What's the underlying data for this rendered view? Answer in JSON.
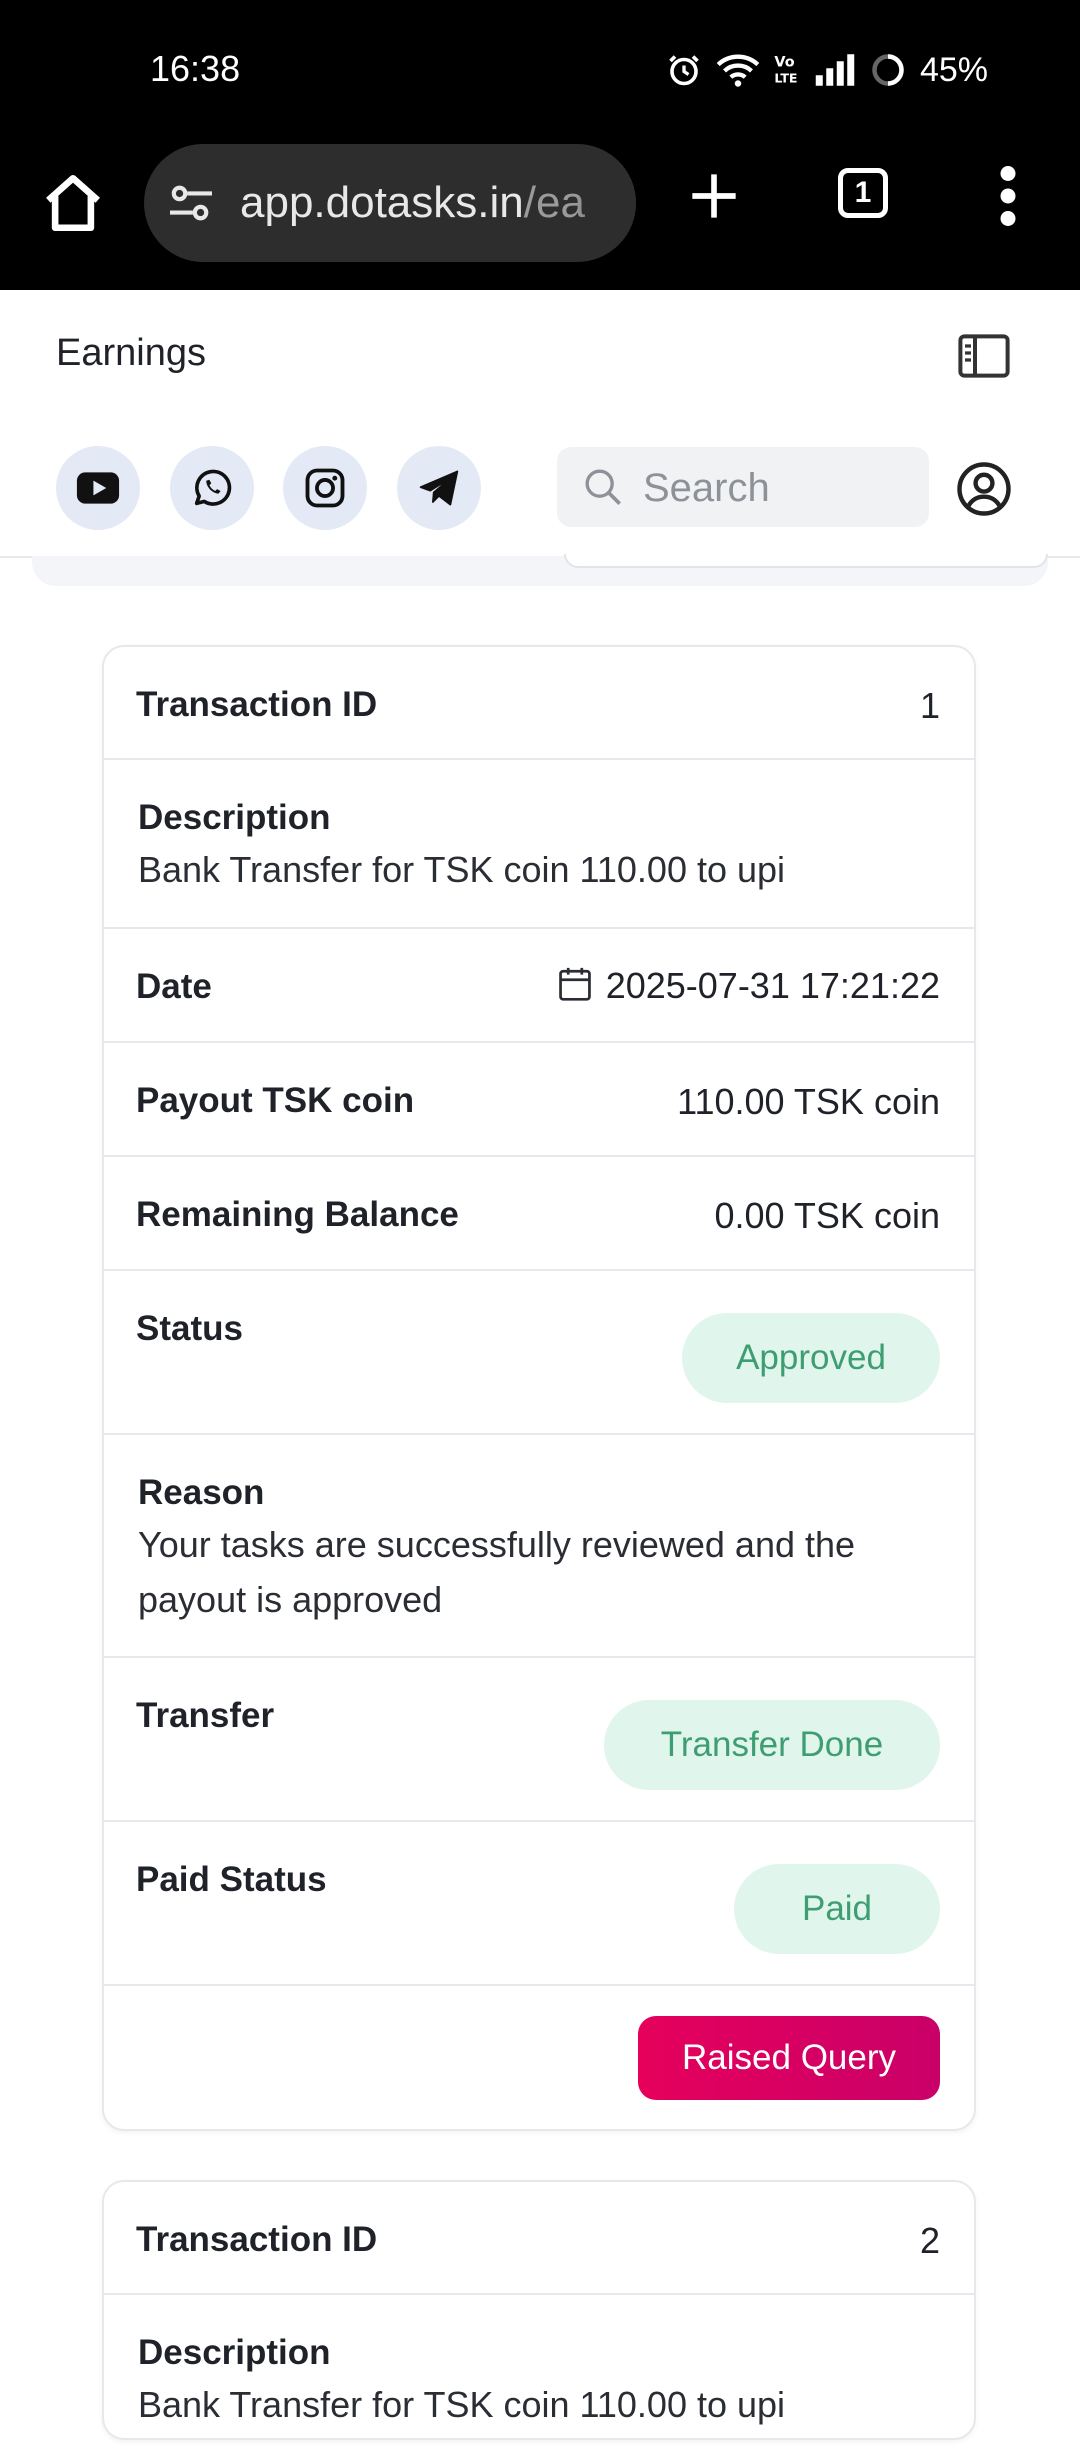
{
  "status_bar": {
    "time": "16:38",
    "battery": "45%",
    "icons": [
      "alarm-icon",
      "wifi-icon",
      "volte-icon",
      "signal-icon",
      "battery-icon"
    ]
  },
  "browser": {
    "url_main": "app.dotasks.in",
    "url_rest": "/ea",
    "tab_count": "1",
    "icons": [
      "home-icon",
      "tune-icon",
      "plus-icon",
      "tabs-icon",
      "more-vert-icon"
    ]
  },
  "header": {
    "title": "Earnings",
    "search_placeholder": "Search",
    "socials": [
      "youtube-icon",
      "whatsapp-icon",
      "instagram-icon",
      "telegram-icon"
    ]
  },
  "colors": {
    "badge_bg": "#e0f6ec",
    "badge_text": "#3f9d72",
    "query_button": "#e6005c",
    "social_bg": "#e3e9f5"
  },
  "transactions": [
    {
      "id_label": "Transaction ID",
      "id": "1",
      "description_label": "Description",
      "description": "Bank Transfer for TSK coin 110.00 to upi",
      "date_label": "Date",
      "date": "2025-07-31 17:21:22",
      "payout_label": "Payout TSK coin",
      "payout": "110.00 TSK coin",
      "balance_label": "Remaining Balance",
      "balance": "0.00 TSK coin",
      "status_label": "Status",
      "status": "Approved",
      "reason_label": "Reason",
      "reason_line1": "Your tasks are successfully reviewed and the",
      "reason_line2": "payout is approved",
      "transfer_label": "Transfer",
      "transfer": "Transfer Done",
      "paid_label": "Paid Status",
      "paid": "Paid",
      "query_button": "Raised Query"
    },
    {
      "id_label": "Transaction ID",
      "id": "2",
      "description_label": "Description",
      "description": "Bank Transfer for TSK coin 110.00 to upi"
    }
  ]
}
